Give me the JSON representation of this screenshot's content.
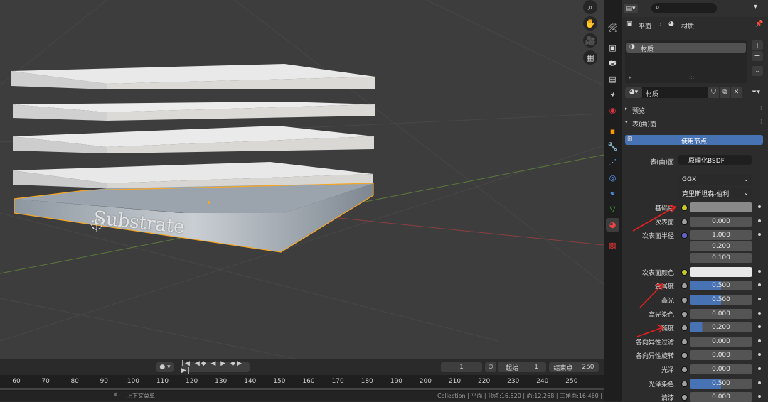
{
  "viewport": {
    "substrate_label": "Substrate",
    "axis_tick_labels": [
      "60",
      "70",
      "80",
      "90",
      "100",
      "110",
      "120",
      "130",
      "140",
      "150",
      "160",
      "170",
      "180",
      "190",
      "200",
      "210",
      "220",
      "230",
      "240",
      "250"
    ]
  },
  "timeline": {
    "current_frame": "1",
    "start_label": "起始",
    "start_value": "1",
    "end_label": "结束点",
    "end_value": "250"
  },
  "status": {
    "left_text": "上下文菜单",
    "right_text": "Collection | 平面 | 顶点:16,520 | 面:12,268 | 三角面:16,460 | 物体:1/10 | 内存: 42.6 MiB | 显存: 2.2/8.0 GiB | 2.93.0"
  },
  "header": {
    "breadcrumb_object": "平面",
    "breadcrumb_material": "材质",
    "search_placeholder": ""
  },
  "material_slots": {
    "items": [
      "材质"
    ]
  },
  "material_name": "材质",
  "panels": {
    "preview": "预览",
    "surface": "表(曲)面",
    "use_nodes": "使用节点"
  },
  "surface": {
    "surface_label": "表(曲)面",
    "shader": "原理化BSDF",
    "distribution": "GGX",
    "subsurface_method": "克里斯坦森-伯利"
  },
  "properties": [
    {
      "label": "基础色",
      "value": "",
      "kind": "color",
      "color": "#8a8a8a"
    },
    {
      "label": "次表面",
      "value": "0.000",
      "kind": "number"
    },
    {
      "label": "次表面半径",
      "value": "1.000",
      "kind": "vector",
      "extra": [
        "0.200",
        "0.100"
      ]
    },
    {
      "label": "次表面颜色",
      "value": "",
      "kind": "color",
      "color": "#e8e8e8"
    },
    {
      "label": "金属度",
      "value": "0.500",
      "kind": "slider",
      "fill": 0.5
    },
    {
      "label": "高光",
      "value": "0.500",
      "kind": "slider",
      "fill": 0.5
    },
    {
      "label": "高光染色",
      "value": "0.000",
      "kind": "number"
    },
    {
      "label": "糙度",
      "value": "0.200",
      "kind": "slider",
      "fill": 0.2
    },
    {
      "label": "各向异性过滤",
      "value": "0.000",
      "kind": "number"
    },
    {
      "label": "各向异性旋转",
      "value": "0.000",
      "kind": "number"
    },
    {
      "label": "光泽",
      "value": "0.000",
      "kind": "number"
    },
    {
      "label": "光泽染色",
      "value": "0.500",
      "kind": "slider",
      "fill": 0.5
    },
    {
      "label": "清漆",
      "value": "0.000",
      "kind": "number"
    }
  ],
  "colors": {
    "accent_blue": "#4772b3",
    "selection_orange": "#f5a623",
    "annotation_red": "#e02020"
  }
}
